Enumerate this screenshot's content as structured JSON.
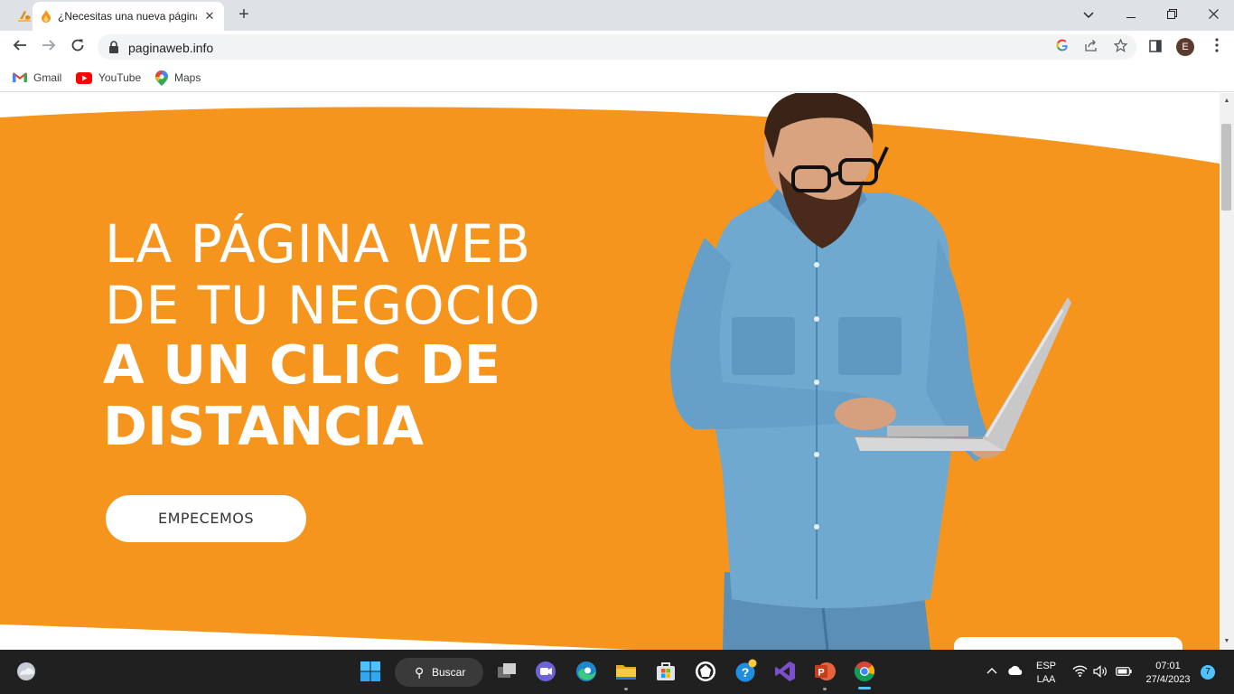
{
  "browser": {
    "tab": {
      "title": "¿Necesitas una nueva página web?"
    },
    "new_tab_label": "+",
    "window": {
      "minimize": "—",
      "maximize": "❐",
      "close": "✕"
    },
    "url": "paginaweb.info",
    "profile_initial": "E",
    "bookmarks": [
      {
        "label": "Gmail",
        "icon": "gmail-icon"
      },
      {
        "label": "YouTube",
        "icon": "youtube-icon"
      },
      {
        "label": "Maps",
        "icon": "maps-icon"
      }
    ]
  },
  "page": {
    "hero": {
      "line1": "LA PÁGINA WEB",
      "line2": "DE TU NEGOCIO",
      "line3": "A UN CLIC DE",
      "line4": "DISTANCIA",
      "cta_label": "EMPECEMOS"
    },
    "colors": {
      "hero_orange": "#f5951e",
      "text_white": "#ffffff"
    }
  },
  "taskbar": {
    "search_label": "Buscar",
    "language": {
      "line1": "ESP",
      "line2": "LAA"
    },
    "clock": {
      "time": "07:01",
      "date": "27/4/2023"
    },
    "notification_count": "7",
    "apps": [
      "widgets-icon",
      "windows-start-icon",
      "task-view-icon",
      "teams-icon",
      "edge-icon",
      "file-explorer-icon",
      "store-icon",
      "app-icon",
      "help-icon",
      "visual-studio-icon",
      "powerpoint-icon",
      "chrome-icon"
    ]
  }
}
